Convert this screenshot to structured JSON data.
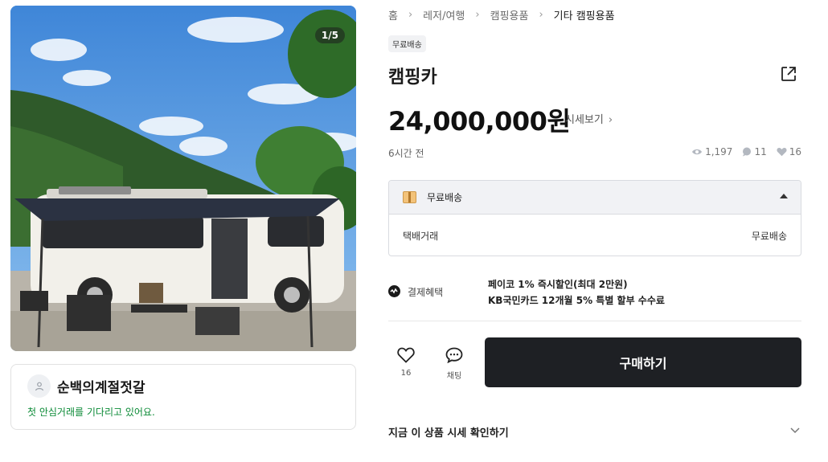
{
  "gallery": {
    "counter": "1/5",
    "image_description": "camper",
    "colors": {
      "sky": "#4a90dc",
      "mountain": "#2f5a2a",
      "van": "#f2f0ea",
      "awning": "#2b3242"
    }
  },
  "seller": {
    "name": "순백의계절젓갈",
    "message": "첫 안심거래를 기다리고 있어요."
  },
  "breadcrumb": [
    "홈",
    "레저/여행",
    "캠핑용품",
    "기타 캠핑용품"
  ],
  "badge": "무료배송",
  "product": {
    "title": "캠핑카",
    "price": "24,000,000원",
    "market_price_link": "시세보기",
    "posted": "6시간 전",
    "views": "1,197",
    "chats": "11",
    "likes": "16"
  },
  "delivery": {
    "header": "무료배송",
    "method": "택배거래",
    "fee": "무료배송"
  },
  "payment": {
    "label": "결제혜택",
    "benefit_1": "페이코 1% 즉시할인(최대 2만원)",
    "benefit_2": "KB국민카드 12개월 5% 특별 할부 수수료"
  },
  "actions": {
    "like_count": "16",
    "chat_label": "채팅",
    "buy_label": "구매하기"
  },
  "market_check": "지금 이 상품 시세 확인하기",
  "icons": [
    "share-icon",
    "eye-icon",
    "chat-bubble-icon",
    "heart-icon",
    "box-icon",
    "payment-icon",
    "chevron-down-icon",
    "user-icon"
  ]
}
